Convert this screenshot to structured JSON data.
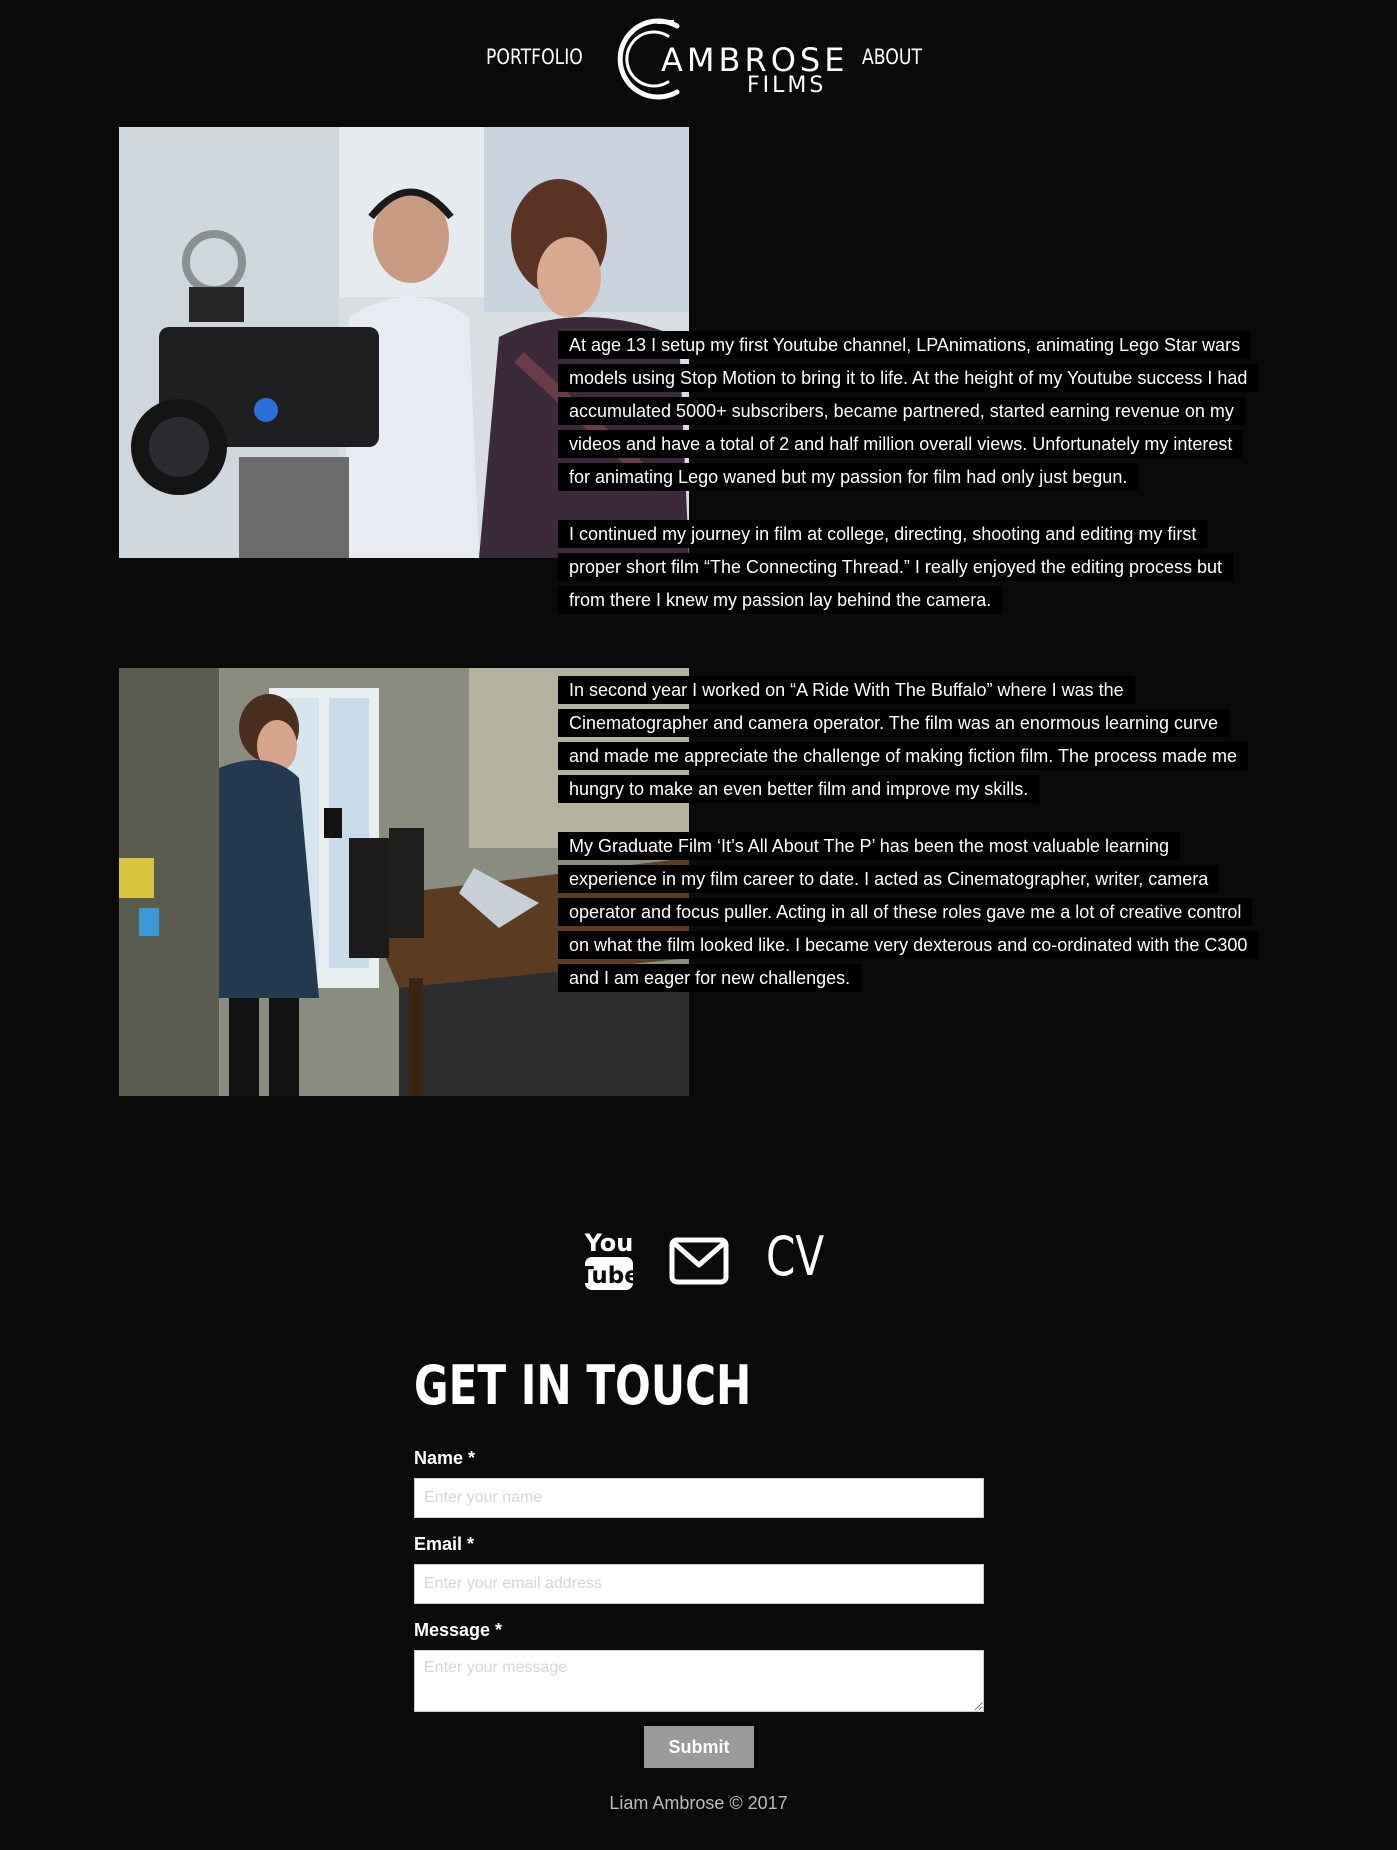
{
  "nav": {
    "portfolio": "PORTFOLIO",
    "about": "ABOUT"
  },
  "logo": {
    "word1": "AMBROSE",
    "word2": "FILMS"
  },
  "bio": [
    "At age 13 I setup my first Youtube channel, LPAnimations, animating Lego Star wars models using Stop Motion to bring it to life. At the height of my Youtube success I had accumulated 5000+ subscribers, became partnered, started earning revenue on my videos and have a total of 2 and half million overall views. Unfortunately my interest for animating Lego waned but my passion for film had only just begun.",
    "I continued my journey in film at college, directing, shooting and editing my first proper short film “The Connecting Thread.” I really enjoyed the editing process but from there I knew my passion lay behind the camera.",
    "In second year I worked on “A Ride With The Buffalo” where I was the Cinematographer and camera operator. The film was an enormous learning curve and made me appreciate the challenge of making fiction film. The process made me hungry to make an even better film and improve my skills.",
    "My Graduate Film ‘It’s All About The P’ has been the most valuable learning experience in my film career to date. I acted as Cinematographer, writer, camera operator and focus puller. Acting in all of these roles gave me a lot of creative control on what the film looked like. I became very dexterous and co-ordinated with the C300 and I am eager for new challenges."
  ],
  "social": {
    "youtube_top": "You",
    "youtube_bottom": "Tube",
    "cv": "CV"
  },
  "contact": {
    "title": "GET IN TOUCH",
    "name_label": "Name *",
    "name_placeholder": "Enter your name",
    "email_label": "Email *",
    "email_placeholder": "Enter your email address",
    "message_label": "Message *",
    "message_placeholder": "Enter your message",
    "submit_label": "Submit"
  },
  "footer": "Liam Ambrose © 2017"
}
